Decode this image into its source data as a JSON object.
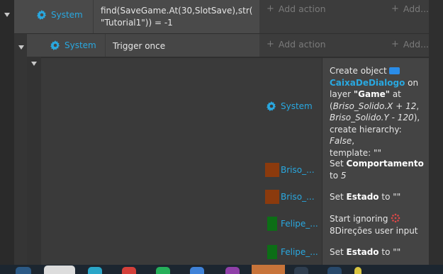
{
  "event1": {
    "condition_object": "System",
    "condition_text": "find(SaveGame.At(30,SlotSave),str( \"Tutorial1\")) = -1",
    "add_action_label": "Add action",
    "add_more_label": "Add..."
  },
  "event2": {
    "condition_object": "System",
    "condition_text": "Trigger once",
    "add_action_label": "Add action",
    "add_more_label": "Add..."
  },
  "actions": [
    {
      "object": "System",
      "icon": "gear-icon",
      "line1": "Create object",
      "object_name": "CaixaDeDialogo",
      "line2": "on",
      "layer_prefix": "layer ",
      "layer_name": "\"Game\"",
      "layer_suffix": " at",
      "pos_open": "(",
      "pos_x": "Briso_Solido.X + 12",
      "pos_comma": ",",
      "pos_y": "Briso_Solido.Y - 120",
      "pos_close": "),",
      "hier_prefix": "create hierarchy: ",
      "hier_value": "False",
      "hier_suffix": ",",
      "template_text": "template: \"\""
    },
    {
      "object": "Briso_...",
      "icon": "brown-sprite-icon",
      "prefix": "Set ",
      "bold": "Comportamento",
      "to": "to ",
      "value": "5"
    },
    {
      "object": "Briso_...",
      "icon": "brown-sprite-icon",
      "prefix": "Set ",
      "bold": "Estado",
      "suffix": " to \"\""
    },
    {
      "object": "Felipe_...",
      "icon": "green-sprite-icon",
      "prefix": "Start ignoring",
      "line2": "8Direções user input"
    },
    {
      "object": "Felipe_...",
      "icon": "green-sprite-icon",
      "prefix": "Set ",
      "bold": "Estado",
      "suffix": " to \"\""
    }
  ],
  "colors": {
    "accent": "#29a8e0",
    "sprite_brown": "#8b3a0d",
    "sprite_green": "#0c6e16"
  }
}
